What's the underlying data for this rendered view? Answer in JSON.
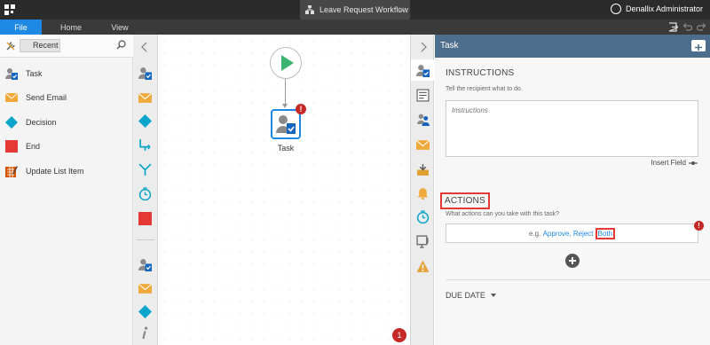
{
  "app": {
    "tab_title": "Leave Request Workflow",
    "user_name": "Denallix Administrator"
  },
  "menu": {
    "file": "File",
    "home": "Home",
    "view": "View"
  },
  "toolbox": {
    "filter_label": "Recent",
    "items": [
      {
        "label": "Task",
        "icon": "task-icon"
      },
      {
        "label": "Send Email",
        "icon": "email-icon"
      },
      {
        "label": "Decision",
        "icon": "decision-icon"
      },
      {
        "label": "End",
        "icon": "end-icon"
      },
      {
        "label": "Update List Item",
        "icon": "update-list-icon"
      }
    ]
  },
  "canvas": {
    "task_label": "Task",
    "task_error_badge": "!",
    "error_count": "1"
  },
  "properties": {
    "header_title": "Task",
    "instructions_title": "INSTRUCTIONS",
    "instructions_hint": "Tell the recipient what to do.",
    "instructions_placeholder": "Instructions",
    "insert_field": "Insert Field",
    "actions_title": "ACTIONS",
    "actions_hint": "What actions can you take with this task?",
    "actions_prefix": "e.g.",
    "actions_approve": "Approve,",
    "actions_reject": "Reject",
    "actions_both": "Both",
    "actions_error_badge": "!",
    "due_date_title": "DUE DATE"
  },
  "colors": {
    "accent": "#1e88e5",
    "error": "#c62828",
    "header": "#4c6d8b",
    "start_green": "#3cb371"
  }
}
